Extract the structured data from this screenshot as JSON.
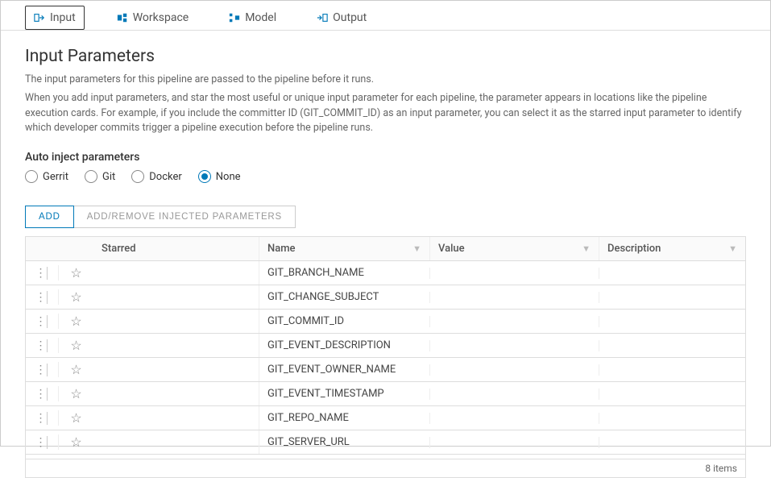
{
  "tabs": [
    {
      "label": "Input",
      "active": true
    },
    {
      "label": "Workspace",
      "active": false
    },
    {
      "label": "Model",
      "active": false
    },
    {
      "label": "Output",
      "active": false
    }
  ],
  "section": {
    "title": "Input Parameters",
    "desc1": "The input parameters for this pipeline are passed to the pipeline before it runs.",
    "desc2": "When you add input parameters, and star the most useful or unique input parameter for each pipeline, the parameter appears in locations like the pipeline execution cards. For example, if you include the committer ID (GIT_COMMIT_ID) as an input parameter, you can select it as the starred input parameter to identify which developer commits trigger a pipeline execution before the pipeline runs."
  },
  "autoInject": {
    "label": "Auto inject parameters",
    "options": [
      {
        "label": "Gerrit",
        "selected": false
      },
      {
        "label": "Git",
        "selected": false
      },
      {
        "label": "Docker",
        "selected": false
      },
      {
        "label": "None",
        "selected": true
      }
    ]
  },
  "buttons": {
    "add": "ADD",
    "addRemove": "ADD/REMOVE INJECTED PARAMETERS"
  },
  "columns": {
    "starred": "Starred",
    "name": "Name",
    "value": "Value",
    "description": "Description"
  },
  "rows": [
    {
      "name": "GIT_BRANCH_NAME",
      "value": "",
      "description": ""
    },
    {
      "name": "GIT_CHANGE_SUBJECT",
      "value": "",
      "description": ""
    },
    {
      "name": "GIT_COMMIT_ID",
      "value": "",
      "description": ""
    },
    {
      "name": "GIT_EVENT_DESCRIPTION",
      "value": "",
      "description": ""
    },
    {
      "name": "GIT_EVENT_OWNER_NAME",
      "value": "",
      "description": ""
    },
    {
      "name": "GIT_EVENT_TIMESTAMP",
      "value": "",
      "description": ""
    },
    {
      "name": "GIT_REPO_NAME",
      "value": "",
      "description": ""
    },
    {
      "name": "GIT_SERVER_URL",
      "value": "",
      "description": ""
    }
  ],
  "footer": {
    "count": "8 items"
  }
}
